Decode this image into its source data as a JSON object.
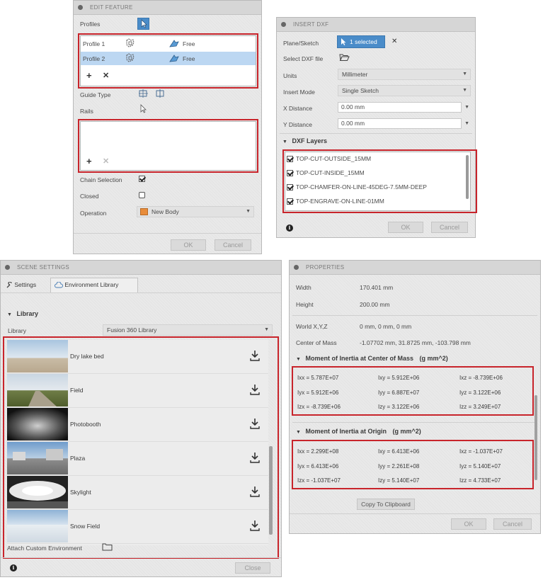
{
  "edit_feature": {
    "title": "EDIT FEATURE",
    "profiles_label": "Profiles",
    "profiles": [
      {
        "name": "Profile 1",
        "type": "Free"
      },
      {
        "name": "Profile 2",
        "type": "Free"
      }
    ],
    "guide_type_label": "Guide Type",
    "rails_label": "Rails",
    "chain_selection_label": "Chain Selection",
    "closed_label": "Closed",
    "operation_label": "Operation",
    "operation_value": "New Body",
    "ok": "OK",
    "cancel": "Cancel"
  },
  "insert_dxf": {
    "title": "INSERT DXF",
    "plane_label": "Plane/Sketch",
    "plane_value": "1 selected",
    "select_file_label": "Select DXF file",
    "units_label": "Units",
    "units_value": "Millimeter",
    "insert_mode_label": "Insert Mode",
    "insert_mode_value": "Single Sketch",
    "x_label": "X Distance",
    "x_value": "0.00 mm",
    "y_label": "Y Distance",
    "y_value": "0.00 mm",
    "layers_heading": "DXF Layers",
    "layers": [
      "TOP-CUT-OUTSIDE_15MM",
      "TOP-CUT-INSIDE_15MM",
      "TOP-CHAMFER-ON-LINE-45DEG-7.5MM-DEEP",
      "TOP-ENGRAVE-ON-LINE-01MM"
    ],
    "ok": "OK",
    "cancel": "Cancel"
  },
  "scene_settings": {
    "title": "SCENE SETTINGS",
    "tab_settings": "Settings",
    "tab_env": "Environment Library",
    "library_heading": "Library",
    "library_label": "Library",
    "library_value": "Fusion 360 Library",
    "environments": [
      "Dry lake bed",
      "Field",
      "Photobooth",
      "Plaza",
      "Skylight",
      "Snow Field"
    ],
    "attach_label": "Attach Custom Environment",
    "close": "Close"
  },
  "properties": {
    "title": "PROPERTIES",
    "width_label": "Width",
    "width_value": "170.401 mm",
    "height_label": "Height",
    "height_value": "200.00 mm",
    "world_label": "World X,Y,Z",
    "world_value": "0 mm, 0 mm, 0 mm",
    "com_label": "Center of Mass",
    "com_value": "-1.07702 mm, 31.8725 mm, -103.798 mm",
    "moi_com_heading": "Moment of Inertia at Center of Mass",
    "moi_com_units": "(g mm^2)",
    "moi_com": [
      [
        "Ixx = 5.787E+07",
        "Ixy = 5.912E+06",
        "Ixz = -8.739E+06"
      ],
      [
        "Iyx = 5.912E+06",
        "Iyy = 6.887E+07",
        "Iyz = 3.122E+06"
      ],
      [
        "Izx = -8.739E+06",
        "Izy = 3.122E+06",
        "Izz = 3.249E+07"
      ]
    ],
    "moi_origin_heading": "Moment of Inertia at Origin",
    "moi_origin_units": "(g mm^2)",
    "moi_origin": [
      [
        "Ixx = 2.299E+08",
        "Ixy = 6.413E+06",
        "Ixz = -1.037E+07"
      ],
      [
        "Iyx = 6.413E+06",
        "Iyy = 2.261E+08",
        "Iyz = 5.140E+07"
      ],
      [
        "Izx = -1.037E+07",
        "Izy = 5.140E+07",
        "Izz = 4.733E+07"
      ]
    ],
    "copy": "Copy To Clipboard",
    "ok": "OK",
    "cancel": "Cancel"
  },
  "colors": {
    "highlight_red": "#c8242b",
    "selection_blue": "#bcd7f2",
    "selected_button": "#4a8cc9"
  }
}
